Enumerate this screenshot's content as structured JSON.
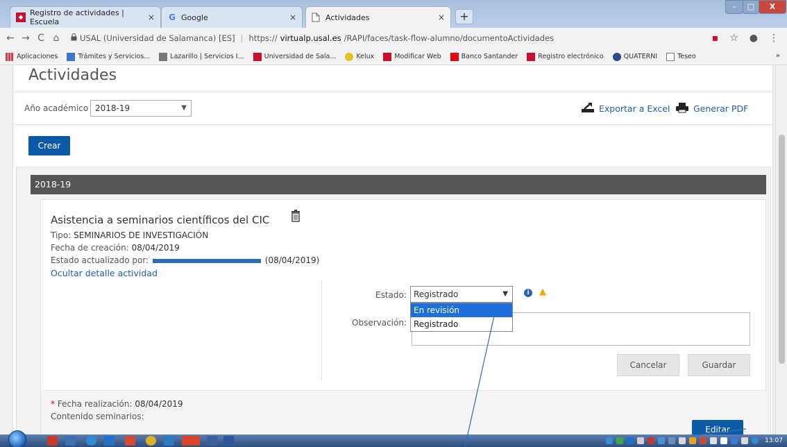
{
  "browser": {
    "tabs": [
      {
        "title": "Registro de actividades | Escuela",
        "favicon": "usal-logo-icon"
      },
      {
        "title": "Google",
        "favicon": "google-icon"
      },
      {
        "title": "Actividades",
        "favicon": "document-icon"
      }
    ],
    "tab_close": "×",
    "new_tab": "+",
    "window_controls": {
      "minimize": "–",
      "maximize": "□",
      "close": "X"
    },
    "nav": {
      "back": "←",
      "forward": "→",
      "reload": "C",
      "home": "⌂"
    },
    "url": {
      "security": "USAL (Universidad de Salamanca) [ES]",
      "scheme": "https://",
      "host": "virtualp.usal.es",
      "path": "/RAPI/faces/task-flow-alumno/documentoActividades"
    },
    "bookmarks": [
      "Aplicaciones",
      "Trámites y Servicios...",
      "Lazarillo | Servicios I...",
      "Universidad de Sala...",
      "Kelux",
      "Modificar Web",
      "Banco Santander",
      "Registro electrónico",
      "QUATERNI",
      "Teseo"
    ],
    "bookmarks_more": "»"
  },
  "page": {
    "title": "Actividades",
    "year_filter": {
      "label": "Año académico",
      "value": "2018-19"
    },
    "export_excel": "Exportar a Excel",
    "generate_pdf": "Generar PDF",
    "create_button": "Crear",
    "year_section": "2018-19",
    "activity": {
      "title": "Asistencia a seminarios científicos del CIC",
      "tipo_label": "Tipo:",
      "tipo_value": "SEMINARIOS DE INVESTIGACIÓN",
      "fecha_creacion_label": "Fecha de creación:",
      "fecha_creacion_value": "08/04/2019",
      "estado_actualizado_label": "Estado actualizado por:",
      "estado_actualizado_date": "(08/04/2019)",
      "hide_detail_link": "Ocultar detalle actividad",
      "estado_label": "Estado:",
      "estado_value": "Registrado",
      "estado_options": [
        "En revisión",
        "Registrado"
      ],
      "observacion_label": "Observación:",
      "cancel_button": "Cancelar",
      "save_button": "Guardar",
      "required_mark": "*",
      "fecha_realizacion_label": "Fecha realización:",
      "fecha_realizacion_value": "08/04/2019",
      "contenido_label": "Contenido seminarios:",
      "edit_button": "Editar"
    }
  },
  "taskbar": {
    "clock": "13:07"
  },
  "colors": {
    "primary_button": "#0b5aa8",
    "link": "#1f5fa9",
    "year_bar": "#555555",
    "dropdown_highlight": "#1e6fd9",
    "annotation_line": "#2f6db3"
  }
}
